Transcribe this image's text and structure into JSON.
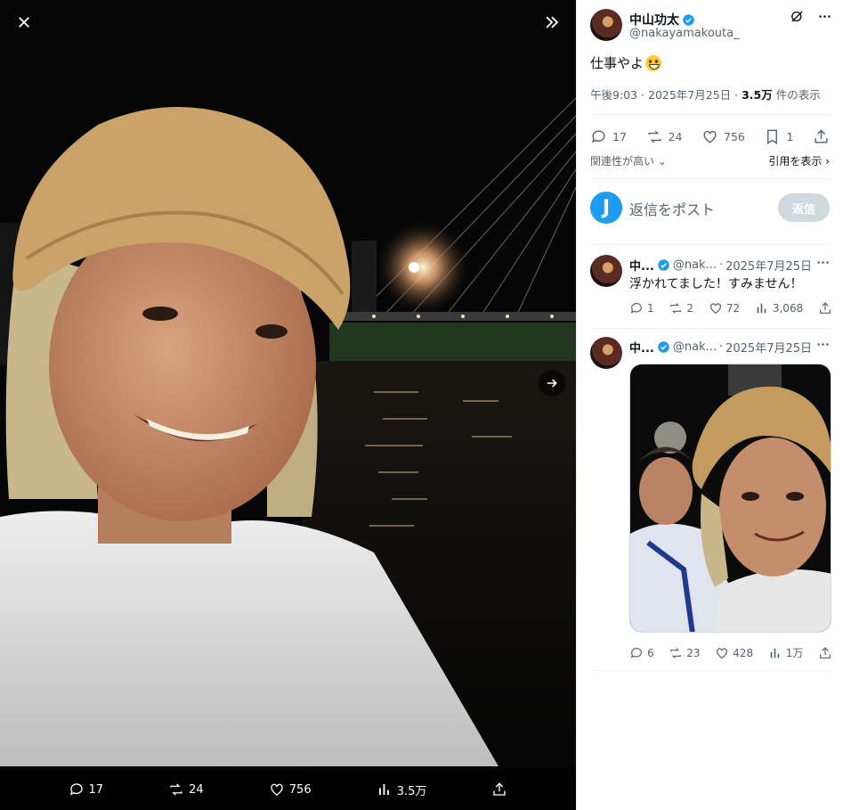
{
  "viewer": {
    "close_icon": "close-icon",
    "expand_icon": "chevrons-right-icon",
    "next_icon": "arrow-right-icon",
    "actions": {
      "replies": "17",
      "reposts": "24",
      "likes": "756",
      "views": "3.5万"
    }
  },
  "post": {
    "display_name": "中山功太",
    "handle": "@nakayamakouta_",
    "text": "仕事やよ",
    "emoji": "grinning-face-emoji",
    "time": "午後9:03",
    "date": "2025年7月25日",
    "views_count": "3.5万",
    "views_label": " 件の表示",
    "stats": {
      "replies": "17",
      "reposts": "24",
      "likes": "756",
      "bookmarks": "1"
    },
    "sort_label": "関連性が高い",
    "quotes_label": "引用を表示"
  },
  "composer": {
    "avatar_letter": "J",
    "placeholder": "返信をポスト",
    "button": "返信"
  },
  "replies": [
    {
      "name": "中...",
      "handle": "@nak...",
      "date": "2025年7月25日",
      "text": "浮かれてました！すみません！",
      "replies": "1",
      "reposts": "2",
      "likes": "72",
      "views": "3,068"
    },
    {
      "name": "中...",
      "handle": "@nak...",
      "date": "2025年7月25日",
      "text": "",
      "replies": "6",
      "reposts": "23",
      "likes": "428",
      "views": "1万"
    }
  ],
  "colors": {
    "accent": "#1d9bf0",
    "muted": "#536471",
    "divider": "#eff3f4"
  }
}
